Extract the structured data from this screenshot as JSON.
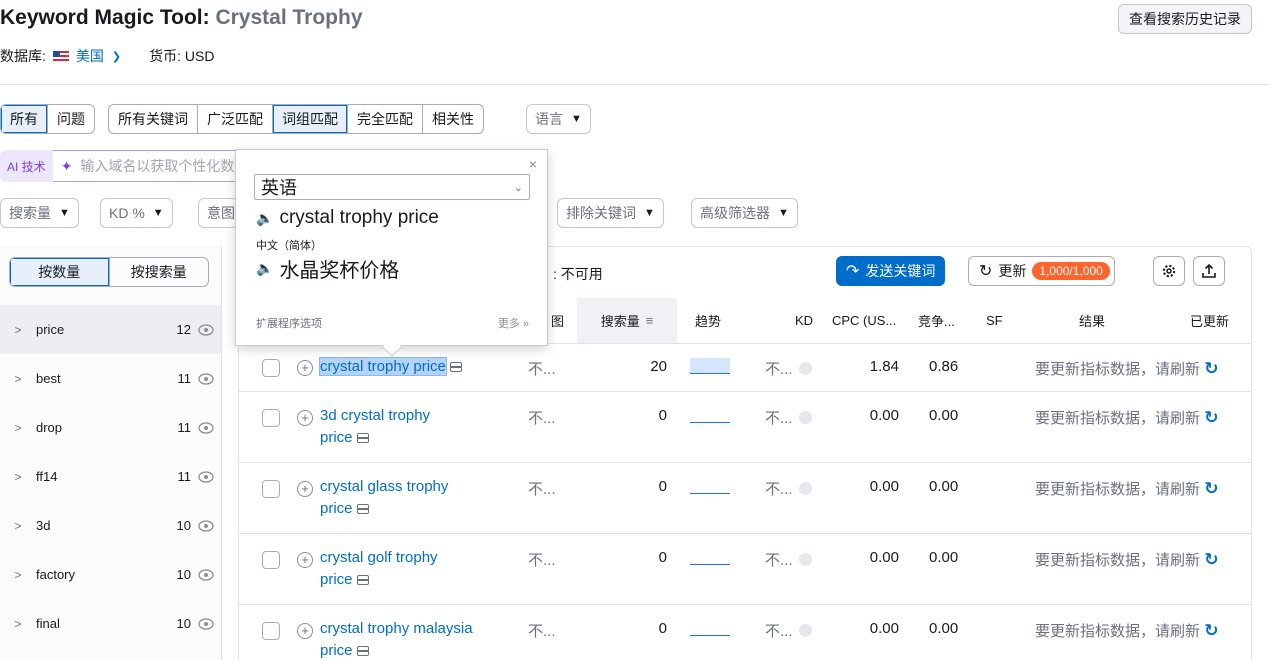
{
  "header": {
    "tool_name": "Keyword Magic Tool:",
    "keyword": "Crystal Trophy",
    "database_label": "数据库:",
    "country": "美国",
    "currency_label": "货币: USD",
    "history_button": "查看搜索历史记录"
  },
  "filters": {
    "type_tabs": [
      "所有",
      "问题"
    ],
    "match_tabs": [
      "所有关键词",
      "广泛匹配",
      "词组匹配",
      "完全匹配",
      "相关性"
    ],
    "active_type": "所有",
    "active_match": "词组匹配",
    "language_dd": "语言",
    "ai_tag": "AI 技术",
    "ai_placeholder": "输入域名以获取个性化数据",
    "volume_dd": "搜索量",
    "kd_dd": "KD %",
    "intent_dd": "意图",
    "exclude_dd": "排除关键词",
    "advanced_dd": "高级筛选器"
  },
  "groups": {
    "toggle": [
      "按数量",
      "按搜索量"
    ],
    "active_toggle": "按数量",
    "items": [
      {
        "name": "price",
        "count": "12"
      },
      {
        "name": "best",
        "count": "11"
      },
      {
        "name": "drop",
        "count": "11"
      },
      {
        "name": "ff14",
        "count": "11"
      },
      {
        "name": "3d",
        "count": "10"
      },
      {
        "name": "factory",
        "count": "10"
      },
      {
        "name": "final",
        "count": "10"
      }
    ]
  },
  "toolbar": {
    "unavailable": ": 不可用",
    "send_button": "发送关键词",
    "update_button": "更新",
    "credits": "1,000/1,000"
  },
  "table": {
    "headers": {
      "intent": "图",
      "volume": "搜索量",
      "trend": "趋势",
      "kd": "KD",
      "cpc": "CPC (US...",
      "competition": "竞争...",
      "sf": "SF",
      "results": "结果",
      "updated": "已更新"
    },
    "rows": [
      {
        "keyword_line1": "crystal trophy price",
        "keyword_line2": "",
        "intent": "不...",
        "volume": "20",
        "kd": "不...",
        "cpc": "1.84",
        "competition": "0.86",
        "results": "要更新指标数据，请刷新"
      },
      {
        "keyword_line1": "3d crystal trophy",
        "keyword_line2": "price",
        "intent": "不...",
        "volume": "0",
        "kd": "不...",
        "cpc": "0.00",
        "competition": "0.00",
        "results": "要更新指标数据，请刷新"
      },
      {
        "keyword_line1": "crystal glass trophy",
        "keyword_line2": "price",
        "intent": "不...",
        "volume": "0",
        "kd": "不...",
        "cpc": "0.00",
        "competition": "0.00",
        "results": "要更新指标数据，请刷新"
      },
      {
        "keyword_line1": "crystal golf trophy",
        "keyword_line2": "price",
        "intent": "不...",
        "volume": "0",
        "kd": "不...",
        "cpc": "0.00",
        "competition": "0.00",
        "results": "要更新指标数据，请刷新"
      },
      {
        "keyword_line1": "crystal trophy malaysia",
        "keyword_line2": "price",
        "intent": "不...",
        "volume": "0",
        "kd": "不...",
        "cpc": "0.00",
        "competition": "0.00",
        "results": "要更新指标数据，请刷新"
      }
    ]
  },
  "translation_popup": {
    "close": "×",
    "source_language": "英语",
    "source_text": "crystal trophy price",
    "target_language": "中文（简体）",
    "target_text": "水晶奖杯价格",
    "options_link": "扩展程序选项",
    "more_link": "更多 »"
  },
  "colors": {
    "brand_blue": "#006dca",
    "badge_orange": "#ff642d",
    "ai_purple": "#7a3fe4"
  }
}
